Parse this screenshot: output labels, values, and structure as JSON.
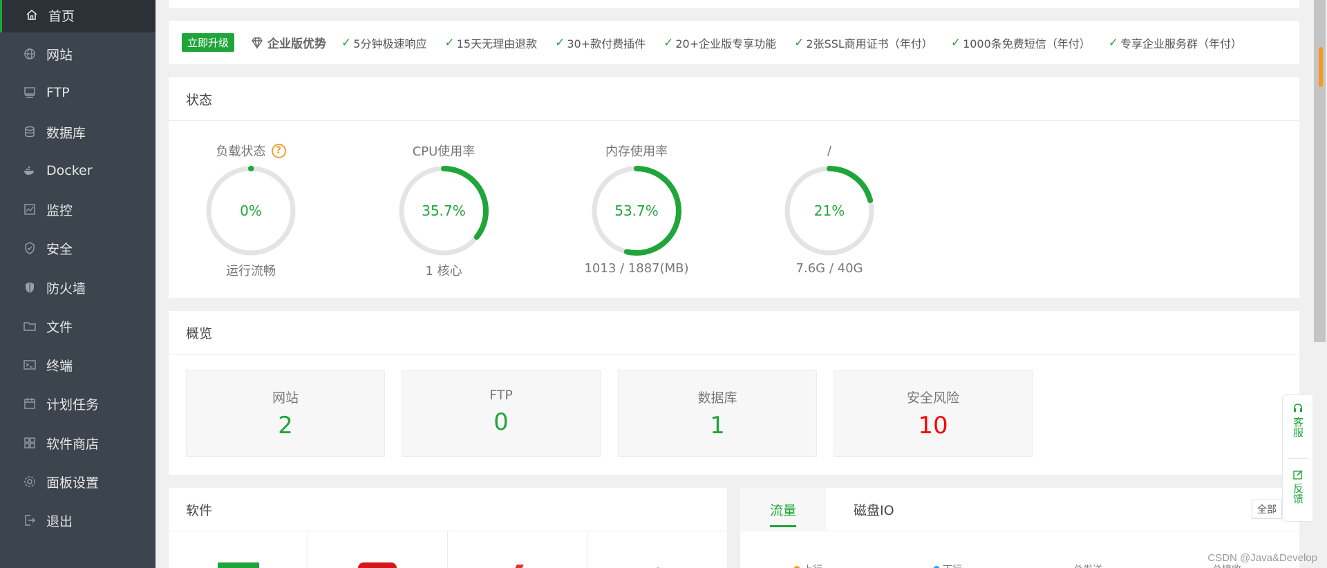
{
  "sidebar": {
    "items": [
      {
        "label": "首页",
        "icon": "home-icon",
        "active": true
      },
      {
        "label": "网站",
        "icon": "globe-icon"
      },
      {
        "label": "FTP",
        "icon": "ftp-icon"
      },
      {
        "label": "数据库",
        "icon": "database-icon"
      },
      {
        "label": "Docker",
        "icon": "docker-icon"
      },
      {
        "label": "监控",
        "icon": "monitor-icon"
      },
      {
        "label": "安全",
        "icon": "shield-check-icon"
      },
      {
        "label": "防火墙",
        "icon": "firewall-icon"
      },
      {
        "label": "文件",
        "icon": "folder-icon"
      },
      {
        "label": "终端",
        "icon": "terminal-icon"
      },
      {
        "label": "计划任务",
        "icon": "calendar-icon"
      },
      {
        "label": "软件商店",
        "icon": "grid-icon"
      },
      {
        "label": "面板设置",
        "icon": "gear-icon"
      },
      {
        "label": "退出",
        "icon": "logout-icon"
      }
    ]
  },
  "upgrade": {
    "button": "立即升级",
    "title": "企业版优势",
    "features": [
      "5分钟极速响应",
      "15天无理由退款",
      "30+款付费插件",
      "20+企业版专享功能",
      "2张SSL商用证书（年付）",
      "1000条免费短信（年付）",
      "专享企业服务群（年付）"
    ]
  },
  "status": {
    "title": "状态",
    "gauges": [
      {
        "label": "负载状态",
        "value": "0%",
        "percent": 0,
        "sub": "运行流畅",
        "help": "?"
      },
      {
        "label": "CPU使用率",
        "value": "35.7%",
        "percent": 35.7,
        "sub": "1 核心"
      },
      {
        "label": "内存使用率",
        "value": "53.7%",
        "percent": 53.7,
        "sub": "1013 / 1887(MB)"
      },
      {
        "label": "/",
        "value": "21%",
        "percent": 21,
        "sub": "7.6G / 40G"
      }
    ]
  },
  "overview": {
    "title": "概览",
    "boxes": [
      {
        "label": "网站",
        "value": "2"
      },
      {
        "label": "FTP",
        "value": "0"
      },
      {
        "label": "数据库",
        "value": "1"
      },
      {
        "label": "安全风险",
        "value": "10"
      }
    ]
  },
  "software": {
    "title": "软件"
  },
  "traffic": {
    "tabs": [
      "流量",
      "磁盘IO"
    ],
    "all_button": "全部",
    "legend_up": "上行",
    "legend_down": "下行",
    "total_sent": "总发送",
    "total_recv": "总接收"
  },
  "float_panel": {
    "service": "客服",
    "feedback": "反馈"
  },
  "watermark": "CSDN @Java&Develop",
  "colors": {
    "accent": "#20a53a",
    "sidebar": "#3c444d",
    "danger": "#ff0000",
    "warning": "#f0a030"
  }
}
